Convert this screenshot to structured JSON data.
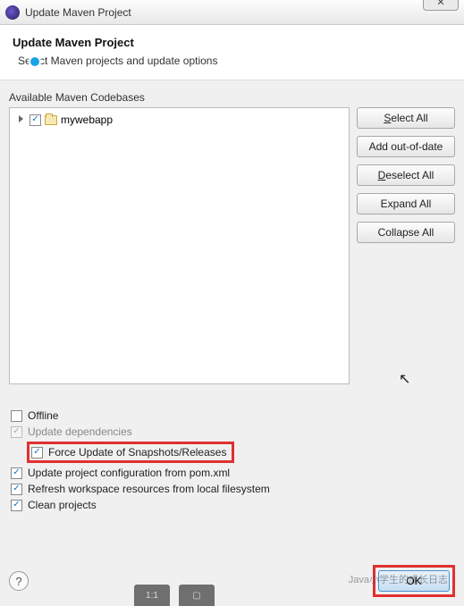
{
  "titlebar": {
    "title": "Update Maven Project",
    "close_glyph": "✕"
  },
  "header": {
    "title": "Update Maven Project",
    "subtitle": "Select Maven projects and update options"
  },
  "tree": {
    "label": "Available Maven Codebases",
    "items": [
      {
        "name": "mywebapp",
        "checked": true
      }
    ]
  },
  "side_buttons": {
    "select_all": "Select All",
    "add_out_of_date": "Add out-of-date",
    "deselect_all": "Deselect All",
    "expand_all": "Expand All",
    "collapse_all": "Collapse All"
  },
  "options": {
    "offline": {
      "label": "Offline",
      "checked": false
    },
    "update_deps": {
      "label": "Update dependencies",
      "checked": true
    },
    "force_update": {
      "label": "Force Update of Snapshots/Releases",
      "checked": true
    },
    "update_config": {
      "label": "Update project configuration from pom.xml",
      "checked": true
    },
    "refresh_ws": {
      "label": "Refresh workspace resources from local filesystem",
      "checked": true
    },
    "clean": {
      "label": "Clean projects",
      "checked": true
    }
  },
  "footer": {
    "help": "?",
    "ok": "OK"
  },
  "watermark": "Java小学生的成长日志",
  "toolbar": {
    "ratio": "1:1",
    "crop": "▢"
  }
}
